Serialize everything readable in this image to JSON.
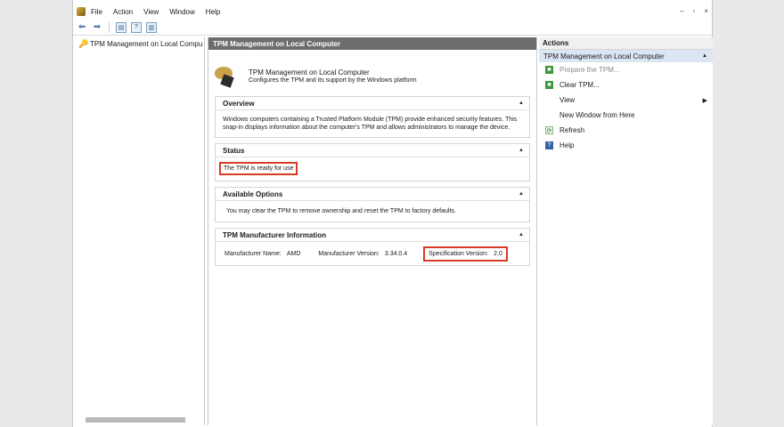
{
  "menu": [
    "File",
    "Action",
    "View",
    "Window",
    "Help"
  ],
  "window_controls": [
    "–",
    "▫",
    "×"
  ],
  "tree": {
    "item": "TPM Management on Local Compu"
  },
  "center": {
    "pane_title": "TPM Management on Local Computer",
    "header_title": "TPM Management on Local Computer",
    "header_subtitle": "Configures the TPM and its support by the Windows platform",
    "overview": {
      "title": "Overview",
      "text": "Windows computers containing a Trusted Platform Module (TPM) provide enhanced security features. This snap-in displays information about the computer's TPM and allows administrators to manage the device."
    },
    "status": {
      "title": "Status",
      "text": "The TPM is ready for use"
    },
    "options": {
      "title": "Available Options",
      "text": "You may clear the TPM to remove ownership and reset the TPM to factory defaults."
    },
    "manufacturer": {
      "title": "TPM Manufacturer Information",
      "name_label": "Manufacturer Name:",
      "name_value": "AMD",
      "version_label": "Manufacturer Version:",
      "version_value": "3.34.0.4",
      "spec_label": "Specification Version:",
      "spec_value": "2.0"
    }
  },
  "actions": {
    "title": "Actions",
    "group": "TPM Management on Local Computer",
    "items": [
      {
        "label": "Prepare the TPM...",
        "icon": "green-action-icon",
        "disabled": true
      },
      {
        "label": "Clear TPM...",
        "icon": "green-action-icon",
        "disabled": false
      },
      {
        "label": "View",
        "icon": "none",
        "disabled": false
      },
      {
        "label": "New Window from Here",
        "icon": "none",
        "disabled": false
      },
      {
        "label": "Refresh",
        "icon": "refresh-icon",
        "disabled": false
      },
      {
        "label": "Help",
        "icon": "help-icon",
        "disabled": false
      }
    ]
  },
  "colors": {
    "highlight_red": "#d83a24",
    "title_bar_gray": "#6d6d6d",
    "action_group_blue": "#dbe6f3"
  }
}
